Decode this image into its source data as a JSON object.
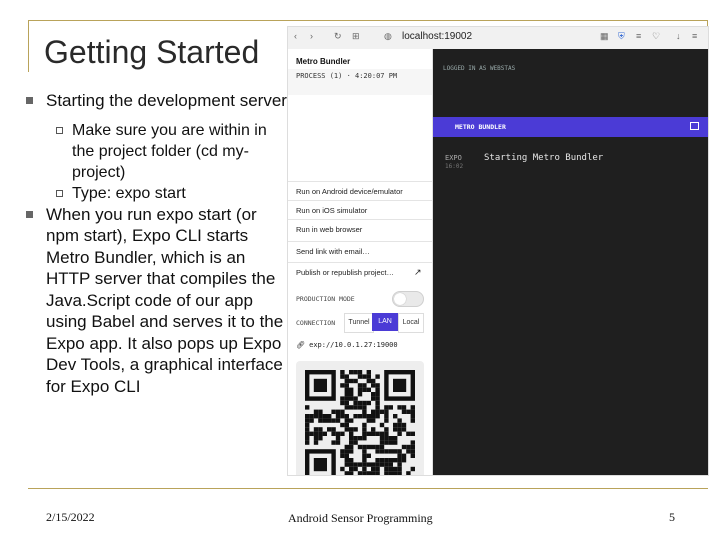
{
  "slide": {
    "title": "Getting Started",
    "bullets": [
      {
        "text": "Starting the development server"
      },
      {
        "text": "Make sure you are within in the project folder (cd my-project)"
      },
      {
        "text": "Type: expo start"
      },
      {
        "text": "When you run expo start (or npm start), Expo CLI starts Metro Bundler, which is an HTTP server that compiles the Java.Script code of our app using Babel and serves it to the Expo app. It also pops up Expo Dev Tools, a graphical interface for Expo CLI"
      }
    ],
    "footer": {
      "date": "2/15/2022",
      "course": "Android Sensor Programming",
      "page": "5"
    }
  },
  "browser": {
    "url": "localhost:19002",
    "left_panel": {
      "title": "Metro Bundler",
      "status_text": "PROCESS (1) · 4:20:07 PM",
      "menu": [
        {
          "label": "Run on Android device/emulator"
        },
        {
          "label": "Run on iOS simulator"
        },
        {
          "label": "Run in web browser"
        },
        {
          "label": "Send link with email…"
        },
        {
          "label": "Publish or republish project…",
          "arrow": "↗"
        }
      ],
      "production_mode_label": "PRODUCTION MODE",
      "connection_label": "CONNECTION",
      "connection_options": [
        "Tunnel",
        "LAN",
        "Local"
      ],
      "connection_selected": "LAN",
      "expo_url": "exp://10.0.1.27:19000"
    },
    "right_panel": {
      "logged_in": "LOGGED IN AS WEBSTAS",
      "bar_label": "METRO BUNDLER",
      "log_source": "EXPO",
      "log_time": "16:02",
      "log_message": "Starting Metro Bundler"
    }
  },
  "colors": {
    "accent": "#4b3bd6",
    "frame": "#b9a35a",
    "dark_panel": "#1f1f1f"
  }
}
